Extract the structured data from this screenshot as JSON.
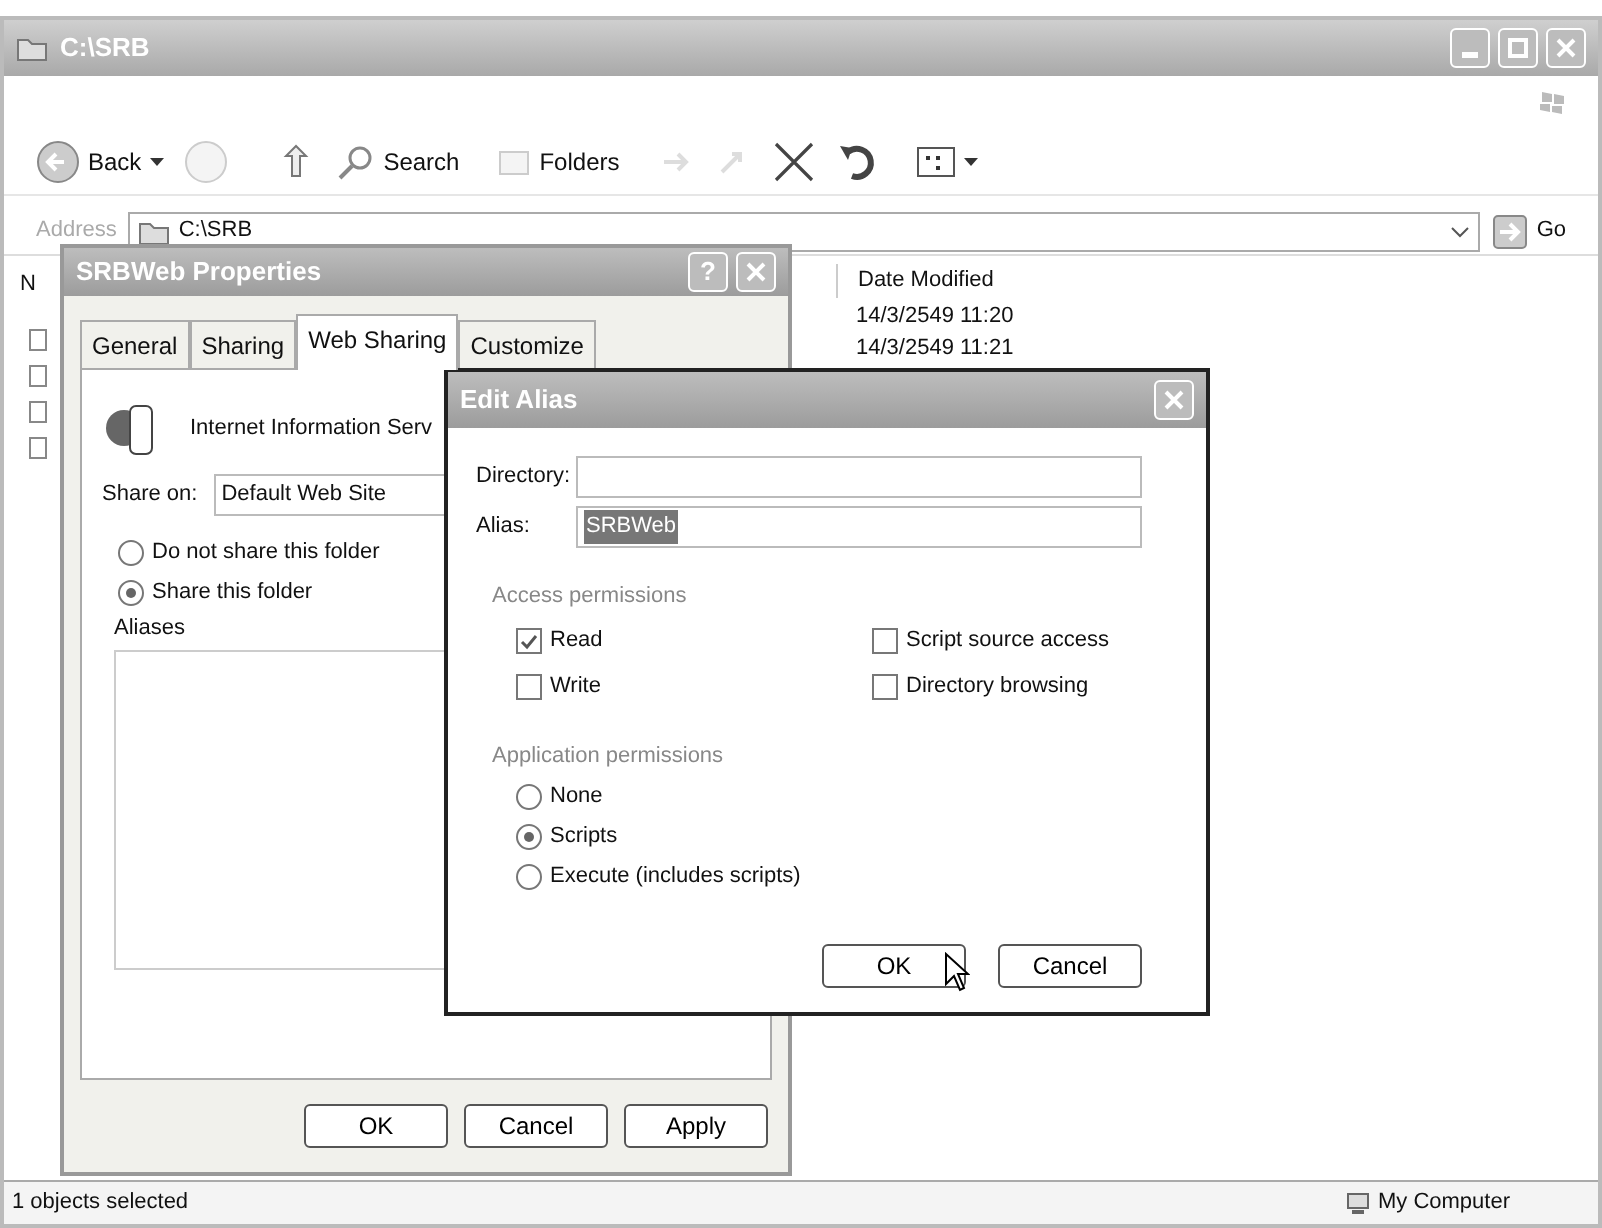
{
  "window": {
    "title": "C:\\SRB"
  },
  "toolbar": {
    "back": "Back",
    "search": "Search",
    "folders": "Folders"
  },
  "address": {
    "label": "Address",
    "value": "C:\\SRB",
    "go": "Go"
  },
  "file_list": {
    "column_1": "N",
    "column_2": "Date Modified",
    "rows": [
      {
        "date": "14/3/2549 11:20"
      },
      {
        "date": "14/3/2549 11:21"
      }
    ]
  },
  "properties_dialog": {
    "title": "SRBWeb Properties",
    "help": "?",
    "tabs": [
      {
        "label": "General",
        "selected": false
      },
      {
        "label": "Sharing",
        "selected": false
      },
      {
        "label": "Web Sharing",
        "selected": true
      },
      {
        "label": "Customize",
        "selected": false
      }
    ],
    "service": "Internet Information Serv",
    "share_on_label": "Share on:",
    "share_on_value": "Default Web Site",
    "options": [
      {
        "label": "Do not share this folder",
        "selected": false
      },
      {
        "label": "Share this folder",
        "selected": true
      }
    ],
    "aliases_label": "Aliases",
    "buttons": [
      "OK",
      "Cancel",
      "Apply"
    ]
  },
  "edit_alias": {
    "title": "Edit Alias",
    "directory_label": "Directory:",
    "alias_label": "Alias:",
    "alias_value": "SRBWeb",
    "alias_highlighted": true,
    "access": {
      "title": "Access permissions",
      "items": [
        {
          "label": "Read",
          "checked": true
        },
        {
          "label": "Script source access",
          "checked": false
        },
        {
          "label": "Write",
          "checked": false
        },
        {
          "label": "Directory browsing",
          "checked": false
        }
      ]
    },
    "application": {
      "title": "Application permissions",
      "options": [
        {
          "label": "None",
          "selected": false
        },
        {
          "label": "Scripts",
          "selected": true
        },
        {
          "label": "Execute (includes scripts)",
          "selected": false
        }
      ]
    },
    "buttons": [
      "OK",
      "Cancel"
    ]
  },
  "status_bar": {
    "left": "1 objects selected",
    "right": "My Computer"
  }
}
